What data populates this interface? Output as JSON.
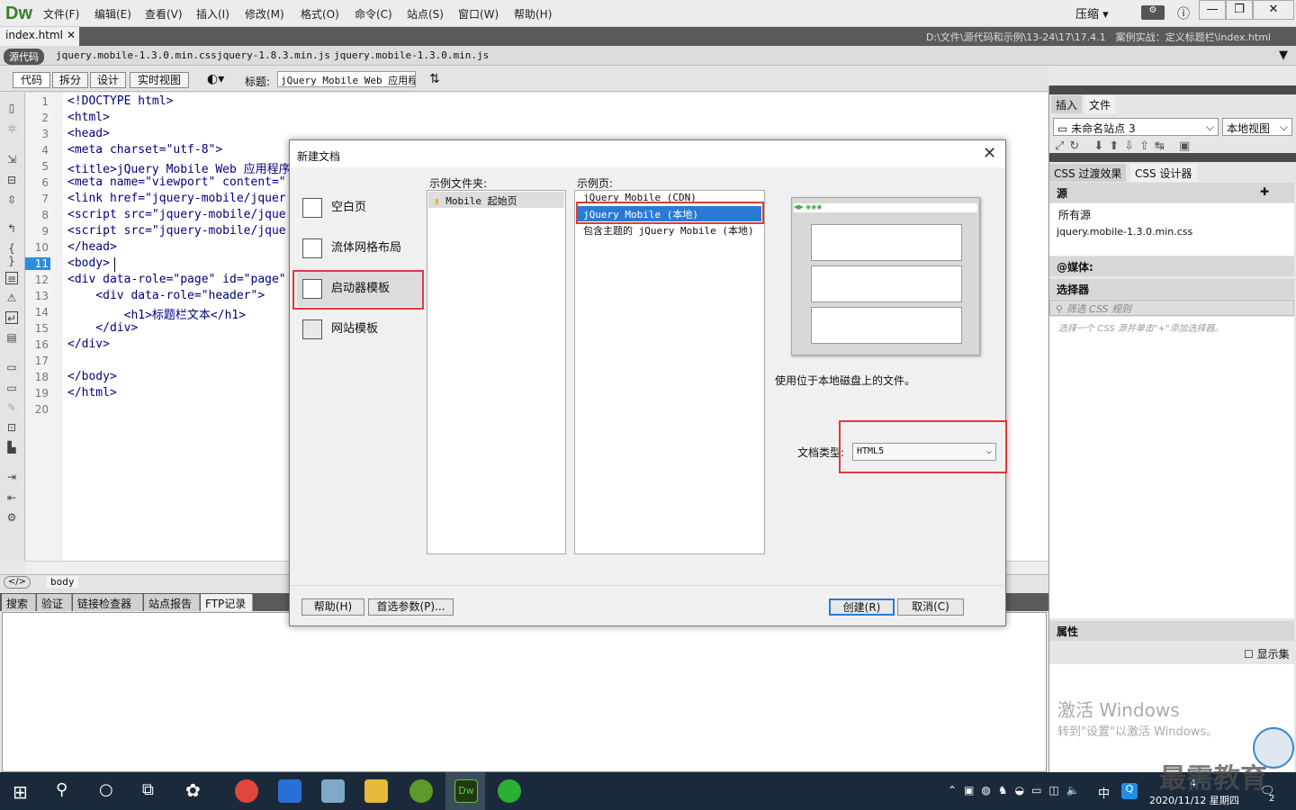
{
  "app": {
    "logo": "Dw"
  },
  "menu": [
    "文件(F)",
    "编辑(E)",
    "查看(V)",
    "插入(I)",
    "修改(M)",
    "格式(O)",
    "命令(C)",
    "站点(S)",
    "窗口(W)",
    "帮助(H)"
  ],
  "toolbar_right": {
    "compress": "压缩"
  },
  "document": {
    "tab": "index.html",
    "path": "D:\\文件\\源代码和示例\\13-24\\17\\17.4.1　案例实战：定义标题栏\\index.html"
  },
  "related_files": {
    "source_label": "源代码",
    "files": [
      "jquery.mobile-1.3.0.min.css",
      "jquery-1.8.3.min.js",
      "jquery.mobile-1.3.0.min.js"
    ]
  },
  "view_buttons": [
    "代码",
    "拆分",
    "设计",
    "实时视图"
  ],
  "title_field": {
    "label": "标题:",
    "value": "jQuery Mobile Web 应用程序"
  },
  "code": {
    "current_line": "11",
    "lines": [
      {
        "n": "1",
        "t": "<!DOCTYPE html>"
      },
      {
        "n": "2",
        "t": "<html>"
      },
      {
        "n": "3",
        "t": "<head>"
      },
      {
        "n": "4",
        "t": "<meta charset=\"utf-8\">"
      },
      {
        "n": "5",
        "t": "<title>jQuery Mobile Web 应用程序"
      },
      {
        "n": "6",
        "t": "<meta name=\"viewport\" content=\""
      },
      {
        "n": "7",
        "t": "<link href=\"jquery-mobile/jquer"
      },
      {
        "n": "8",
        "t": "<script src=\"jquery-mobile/jque"
      },
      {
        "n": "9",
        "t": "<script src=\"jquery-mobile/jque"
      },
      {
        "n": "10",
        "t": "</head>"
      },
      {
        "n": "11",
        "t": "<body> "
      },
      {
        "n": "12",
        "t": "<div data-role=\"page\" id=\"page\""
      },
      {
        "n": "13",
        "t": "    <div data-role=\"header\">"
      },
      {
        "n": "14",
        "t": "        <h1>标题栏文本</h1>"
      },
      {
        "n": "15",
        "t": "    </div>"
      },
      {
        "n": "16",
        "t": "</div>"
      },
      {
        "n": "17",
        "t": ""
      },
      {
        "n": "18",
        "t": "</body>"
      },
      {
        "n": "19",
        "t": "</html>"
      },
      {
        "n": "20",
        "t": ""
      }
    ]
  },
  "tag_selector": {
    "tag": "body"
  },
  "bottom_tabs": [
    "搜索",
    "验证",
    "链接检查器",
    "站点报告",
    "FTP记录"
  ],
  "right_panel": {
    "tabs_top": [
      "插入",
      "文件"
    ],
    "site_select": "未命名站点 3",
    "view_select": "本地视图",
    "tabs_css": [
      "CSS 过渡效果",
      "CSS 设计器"
    ],
    "sources_head": "源",
    "sources": [
      "所有源",
      "jquery.mobile-1.3.0.min.css"
    ],
    "media_head": "@媒体:",
    "selectors_head": "选择器",
    "filter_placeholder": "筛选 CSS 规则",
    "selector_hint": "选择一个 CSS 源并单击\"+\"添加选择器。",
    "props_head": "属性",
    "show_set": "显示集"
  },
  "dialog": {
    "title": "新建文档",
    "categories": [
      "空白页",
      "流体网格布局",
      "启动器模板",
      "网站模板"
    ],
    "selected_category": "启动器模板",
    "folder_label": "示例文件夹:",
    "folders": [
      "Mobile 起始页"
    ],
    "page_label": "示例页:",
    "pages": [
      "jQuery Mobile (CDN)",
      "jQuery Mobile (本地)",
      "包含主题的 jQuery Mobile (本地)"
    ],
    "selected_page": "jQuery Mobile (本地)",
    "description": "使用位于本地磁盘上的文件。",
    "doctype_label": "文档类型:",
    "doctype_value": "HTML5",
    "buttons": {
      "help": "帮助(H)",
      "prefs": "首选参数(P)...",
      "create": "创建(R)",
      "cancel": "取消(C)"
    }
  },
  "watermark": {
    "activate_title": "激活 Windows",
    "activate_sub": "转到\"设置\"以激活 Windows。",
    "brand": "最需教育"
  },
  "taskbar": {
    "ime": "中",
    "time": "4",
    "date": "2020/11/12 星期四",
    "badge": "2"
  }
}
